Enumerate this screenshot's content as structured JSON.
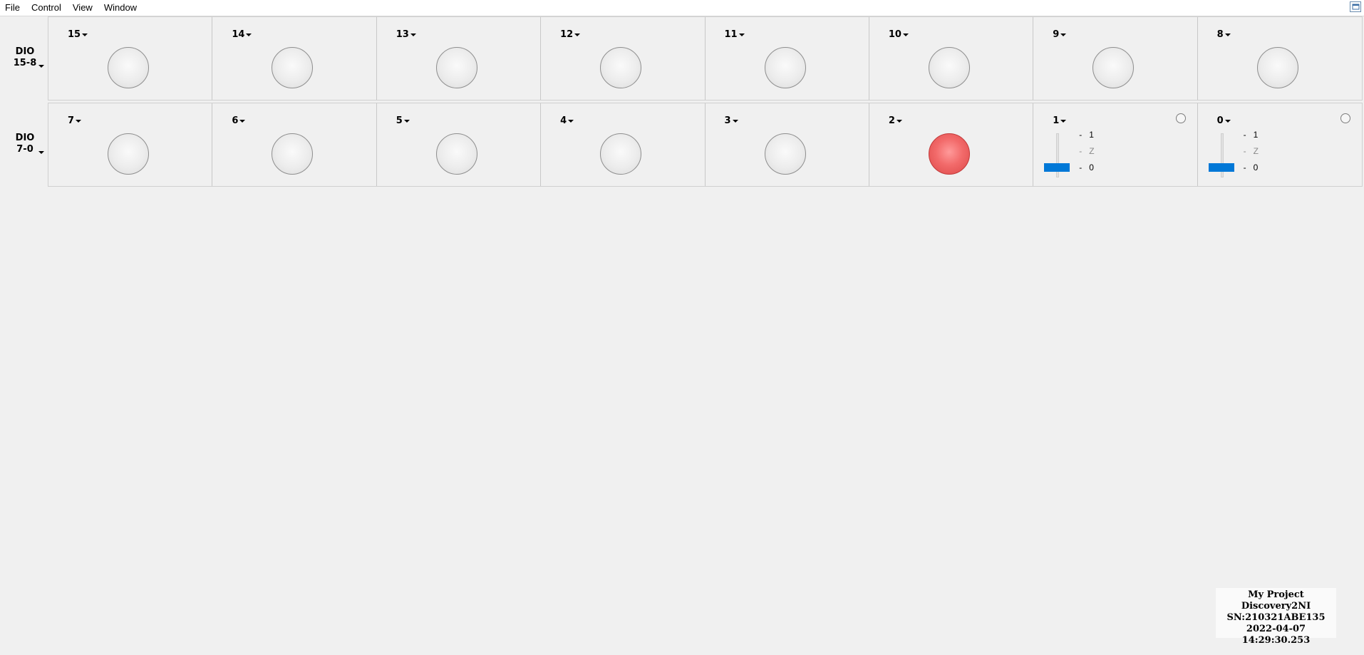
{
  "menubar": {
    "items": [
      "File",
      "Control",
      "View",
      "Window"
    ],
    "restore_icon": "window-restore-icon"
  },
  "groups": [
    {
      "label_line1": "DIO",
      "label_line2": "15-8",
      "pins": [
        {
          "label": "15",
          "led": "off"
        },
        {
          "label": "14",
          "led": "off"
        },
        {
          "label": "13",
          "led": "off"
        },
        {
          "label": "12",
          "led": "off"
        },
        {
          "label": "11",
          "led": "off"
        },
        {
          "label": "10",
          "led": "off"
        },
        {
          "label": "9",
          "led": "off"
        },
        {
          "label": "8",
          "led": "off"
        }
      ]
    },
    {
      "label_line1": "DIO",
      "label_line2": "7-0",
      "pins": [
        {
          "label": "7",
          "led": "off"
        },
        {
          "label": "6",
          "led": "off"
        },
        {
          "label": "5",
          "led": "off"
        },
        {
          "label": "4",
          "led": "off"
        },
        {
          "label": "3",
          "led": "off"
        },
        {
          "label": "2",
          "led": "on"
        },
        {
          "label": "1",
          "type": "output",
          "levels": [
            "1",
            "Z",
            "0"
          ],
          "value": "0"
        },
        {
          "label": "0",
          "type": "output",
          "levels": [
            "1",
            "Z",
            "0"
          ],
          "value": "0"
        }
      ]
    }
  ],
  "colors": {
    "led_on": "#e85a5a",
    "slider": "#0078d7"
  },
  "device_info": {
    "project": "My Project",
    "device": "Discovery2NI",
    "serial": "SN:210321ABE135",
    "timestamp": "2022-04-07 14:29:30.253"
  }
}
